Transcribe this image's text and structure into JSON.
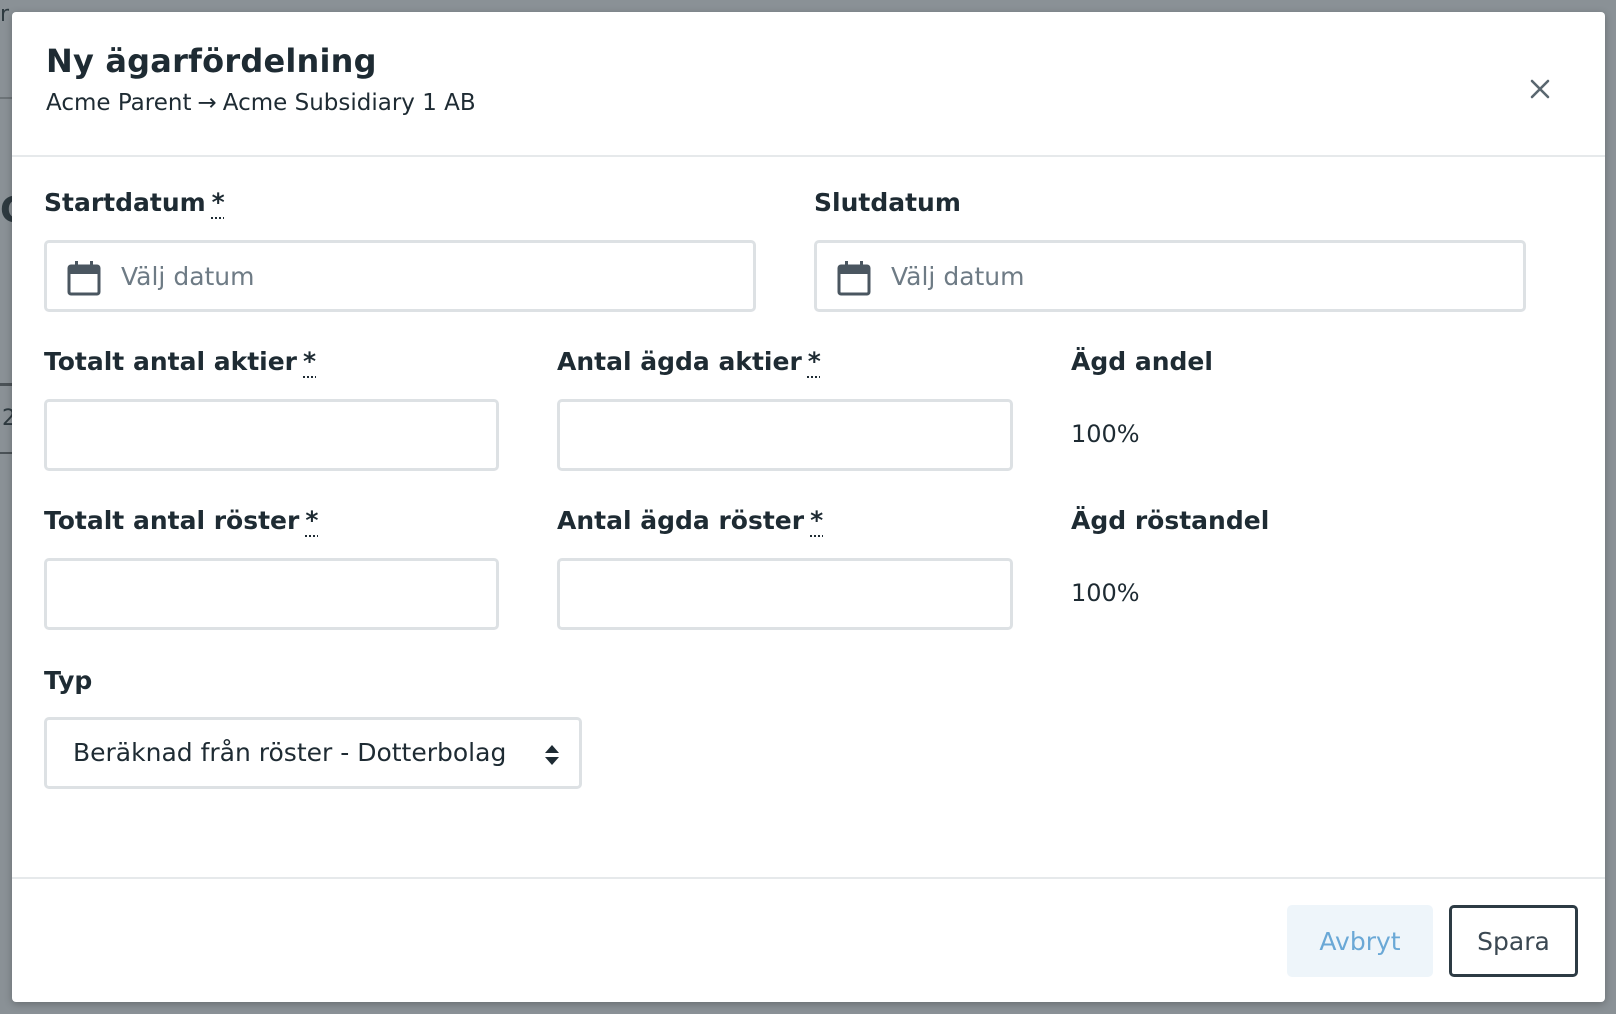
{
  "background": {
    "fragments": [
      "r",
      "C",
      "2"
    ]
  },
  "modal": {
    "title": "Ny ägarfördelning",
    "subtitle_from": "Acme Parent",
    "subtitle_arrow": "→",
    "subtitle_to": "Acme Subsidiary 1 AB"
  },
  "form": {
    "start_date": {
      "label": "Startdatum",
      "required_mark": "*",
      "placeholder": "Välj datum",
      "value": ""
    },
    "end_date": {
      "label": "Slutdatum",
      "placeholder": "Välj datum",
      "value": ""
    },
    "total_shares": {
      "label": "Totalt antal aktier",
      "required_mark": "*",
      "value": ""
    },
    "owned_shares": {
      "label": "Antal ägda aktier",
      "required_mark": "*",
      "value": ""
    },
    "owned_share": {
      "label": "Ägd andel",
      "value": "100%"
    },
    "total_votes": {
      "label": "Totalt antal röster",
      "required_mark": "*",
      "value": ""
    },
    "owned_votes": {
      "label": "Antal ägda röster",
      "required_mark": "*",
      "value": ""
    },
    "owned_vote_share": {
      "label": "Ägd röstandel",
      "value": "100%"
    },
    "type": {
      "label": "Typ",
      "selected": "Beräknad från röster - Dotterbolag"
    }
  },
  "footer": {
    "cancel_label": "Avbryt",
    "save_label": "Spara"
  },
  "colors": {
    "overlay": "#8a9196",
    "text": "#1e2b33",
    "border": "#dde1e4",
    "cancel_bg": "#eef5fa",
    "cancel_text": "#6aa8d6",
    "save_border": "#2d3b44"
  },
  "icons": {
    "close": "close-icon",
    "calendar": "calendar-icon",
    "select": "select-arrows-icon"
  }
}
